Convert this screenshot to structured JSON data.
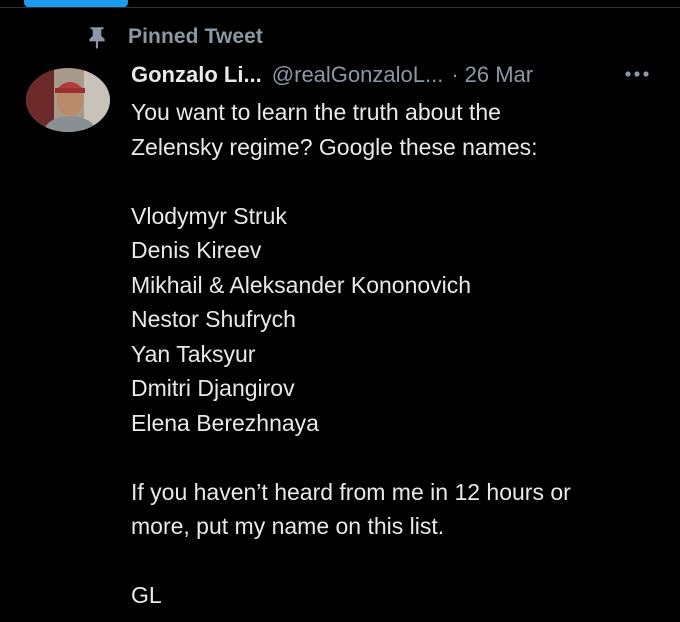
{
  "pinned": {
    "label": "Pinned Tweet",
    "icon": "pin-icon"
  },
  "tweet": {
    "author_name": "Gonzalo Li...",
    "author_handle": "@realGonzaloL...",
    "separator": "·",
    "date": "26 Mar",
    "more_icon": "more-horizontal-icon",
    "intro_lines": [
      "You want to learn the truth about the",
      "Zelensky regime? Google these names:"
    ],
    "names": [
      "Vlodymyr Struk",
      "Denis Kireev",
      "Mikhail & Aleksander Kononovich",
      "Nestor Shufrych",
      "Yan Taksyur",
      "Dmitri Djangirov",
      "Elena Berezhnaya"
    ],
    "closing_lines": [
      "If you haven’t heard from me in 12 hours or",
      "more, put my name on this list."
    ],
    "signoff": "GL"
  },
  "colors": {
    "background": "#000000",
    "text_primary": "#e7e9ea",
    "text_secondary": "#8b98a5",
    "accent": "#1d9bf0",
    "divider": "#2f3336"
  }
}
